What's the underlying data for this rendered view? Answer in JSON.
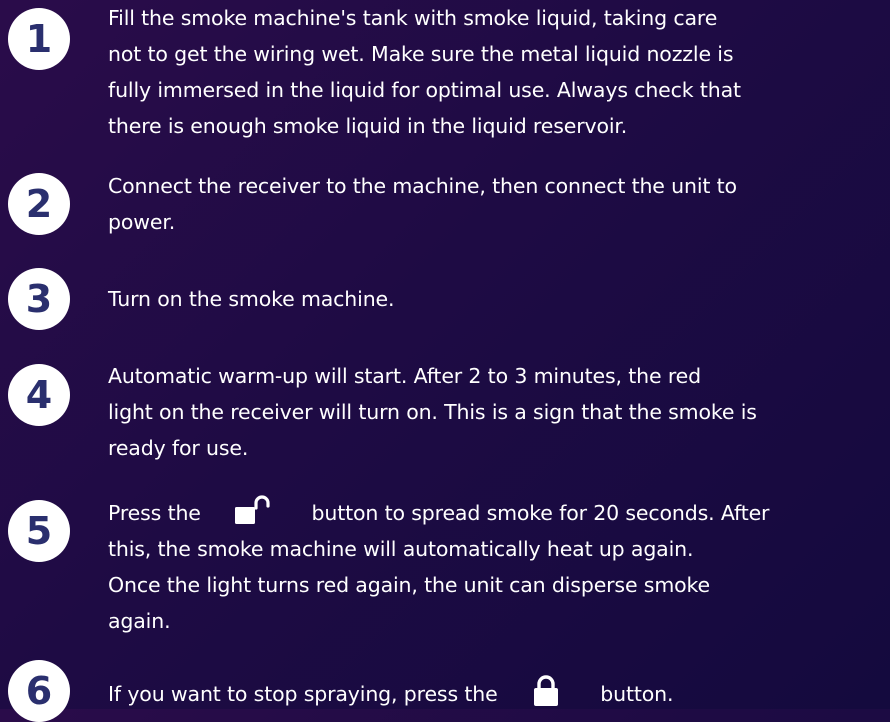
{
  "steps": [
    {
      "number": "1",
      "lines": [
        "Fill the smoke machine's tank with smoke liquid, taking care",
        "not to get the wiring wet. Make sure the metal liquid nozzle is",
        "fully immersed in the liquid for optimal use. Always check that",
        "there is enough smoke liquid in the liquid reservoir."
      ]
    },
    {
      "number": "2",
      "lines": [
        "Connect the receiver to the machine, then connect the unit to",
        "power."
      ]
    },
    {
      "number": "3",
      "lines": [
        "Turn on the smoke machine."
      ]
    },
    {
      "number": "4",
      "lines": [
        "Automatic warm-up will start. After 2 to 3 minutes, the red",
        "light on the receiver will turn on. This is a sign that the smoke is",
        "ready for use."
      ]
    },
    {
      "number": "5",
      "line1_before_icon": "Press the",
      "line1_after_icon": "button to spread smoke for 20 seconds. After",
      "icon": "unlocked-padlock-icon",
      "lines": [
        "this, the smoke machine will automatically heat up again.",
        "Once the light turns red again, the unit can disperse smoke",
        "again."
      ]
    },
    {
      "number": "6",
      "line1_before_icon": "If you want to stop spraying, press the",
      "line1_after_icon": "button.",
      "icon": "locked-padlock-icon"
    }
  ],
  "colors": {
    "background_start": "#2a0c4a",
    "background_end": "#140a3e",
    "badge_bg": "#ffffff",
    "badge_text": "#2a2f6e",
    "text": "#ffffff"
  }
}
